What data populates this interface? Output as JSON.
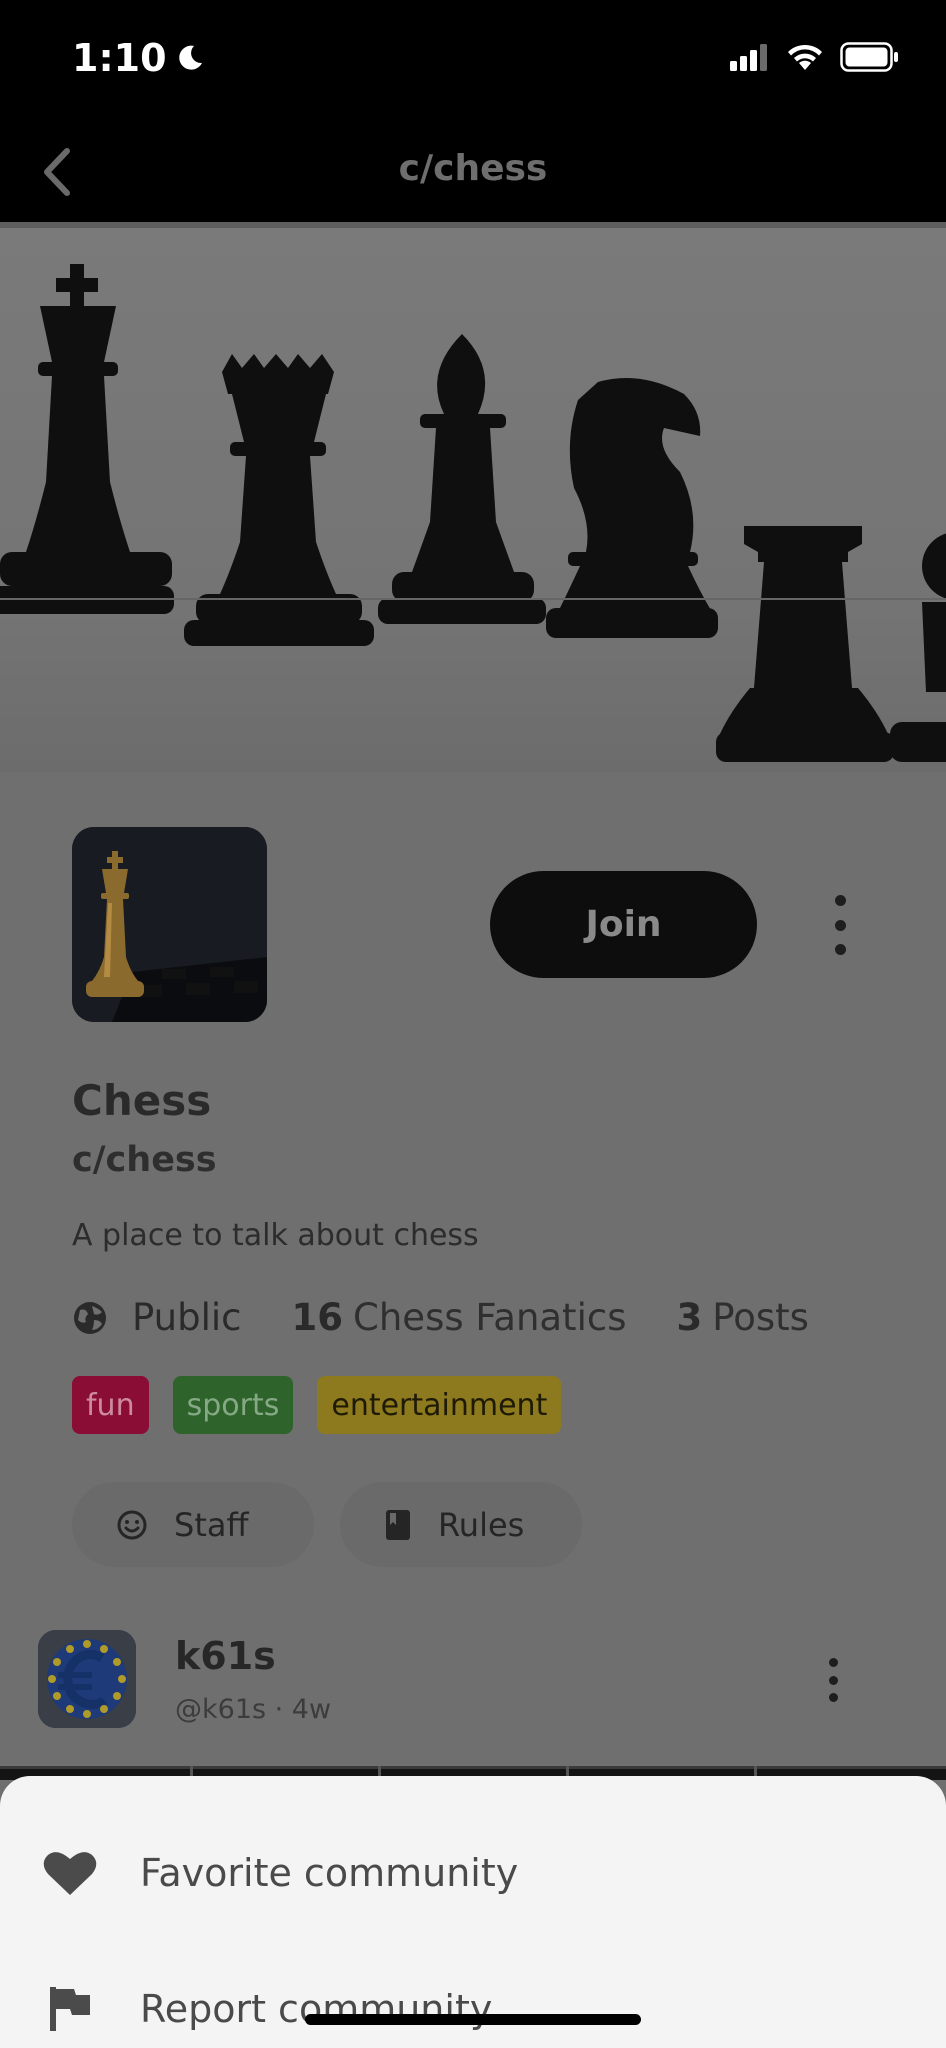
{
  "status_bar": {
    "time": "1:10"
  },
  "nav": {
    "title": "c/chess"
  },
  "community": {
    "name": "Chess",
    "handle": "c/chess",
    "description": "A place to talk about chess",
    "join_label": "Join",
    "visibility": "Public",
    "members_count": "16",
    "members_label": "Chess Fanatics",
    "posts_count": "3",
    "posts_label": "Posts",
    "tags": [
      {
        "label": "fun",
        "color": "#8a0d35"
      },
      {
        "label": "sports",
        "color": "#2e632c"
      },
      {
        "label": "entertainment",
        "color": "#8d7a1f"
      }
    ],
    "chips": [
      {
        "label": "Staff",
        "icon": "smiley-icon"
      },
      {
        "label": "Rules",
        "icon": "book-icon"
      }
    ]
  },
  "post": {
    "username": "k61s",
    "meta": "@k61s · 4w"
  },
  "sheet": {
    "items": [
      {
        "label": "Favorite community",
        "icon": "heart-icon"
      },
      {
        "label": "Report community",
        "icon": "flag-icon"
      }
    ]
  }
}
